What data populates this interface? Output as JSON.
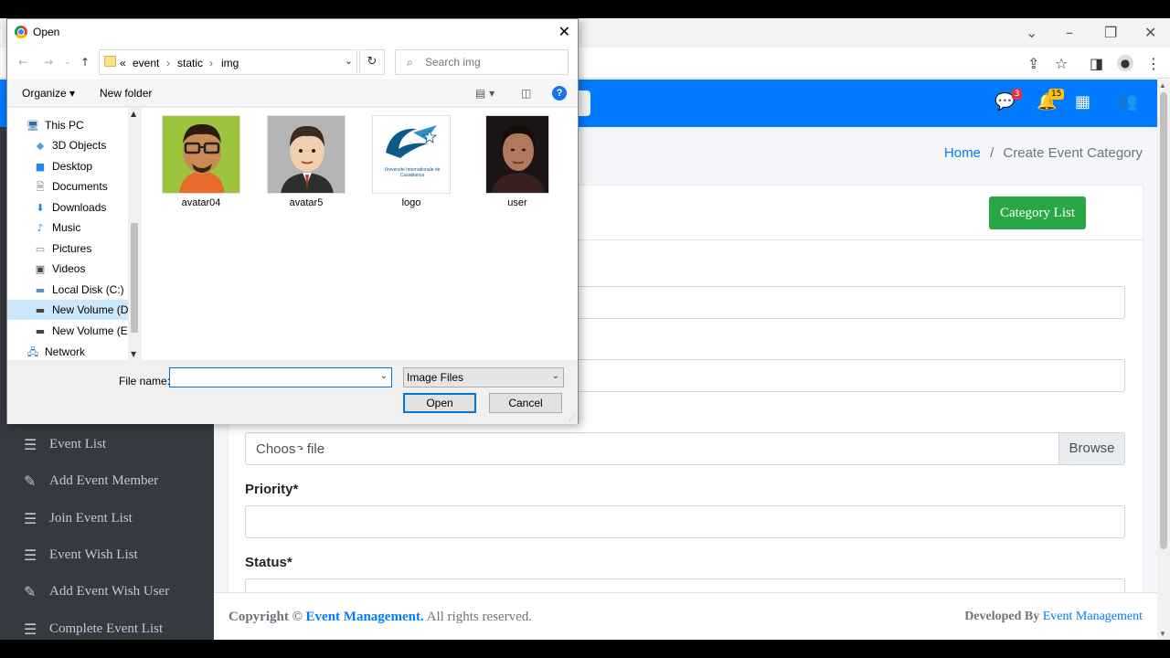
{
  "browser": {
    "controls": {
      "minimize": "–",
      "restore": "❐",
      "close": "✕",
      "tab_list": "⌄"
    }
  },
  "page": {
    "breadcrumb": {
      "home": "Home",
      "separator": "/",
      "current": "Create Event Category"
    },
    "navbar": {
      "messages_badge": "3",
      "notifications_badge": "15"
    },
    "header_button": "Category List",
    "fields": {
      "image_browse": "Browse",
      "image_placeholder": "Choose file",
      "priority_label": "Priority*",
      "status_label": "Status*"
    },
    "sidebar": [
      {
        "label": "Event List",
        "icon": "list-icon"
      },
      {
        "label": "Add Event Member",
        "icon": "edit-icon"
      },
      {
        "label": "Join Event List",
        "icon": "list-icon"
      },
      {
        "label": "Event Wish List",
        "icon": "list-icon"
      },
      {
        "label": "Add Event Wish User",
        "icon": "edit-icon"
      },
      {
        "label": "Complete Event List",
        "icon": "list-icon"
      }
    ],
    "footer": {
      "copyright_prefix": "Copyright ©",
      "brand": "Event Management.",
      "rights": "All rights reserved.",
      "developed_by": "Developed By",
      "developer": "Event Management"
    }
  },
  "dialog": {
    "title": "Open",
    "path": {
      "overflow": "«",
      "segments": [
        "event",
        "static",
        "img"
      ],
      "sep": "›"
    },
    "search_placeholder": "Search img",
    "toolbar": {
      "organize": "Organize ▾",
      "new_folder": "New folder"
    },
    "tree": [
      {
        "label": "This PC",
        "icon": "pc-icon"
      },
      {
        "label": "3D Objects",
        "icon": "cube-icon"
      },
      {
        "label": "Desktop",
        "icon": "desktop-icon"
      },
      {
        "label": "Documents",
        "icon": "document-icon"
      },
      {
        "label": "Downloads",
        "icon": "download-icon"
      },
      {
        "label": "Music",
        "icon": "music-icon"
      },
      {
        "label": "Pictures",
        "icon": "pictures-icon"
      },
      {
        "label": "Videos",
        "icon": "video-icon"
      },
      {
        "label": "Local Disk (C:)",
        "icon": "disk-icon"
      },
      {
        "label": "New Volume (D:)",
        "icon": "drive-icon",
        "selected": true
      },
      {
        "label": "New Volume (E:)",
        "icon": "drive-icon"
      },
      {
        "label": "Network",
        "icon": "network-icon"
      }
    ],
    "files": [
      {
        "name": "avatar04"
      },
      {
        "name": "avatar5"
      },
      {
        "name": "logo",
        "logo_text": "Université Internationale de Casablanca"
      },
      {
        "name": "user"
      }
    ],
    "file_name_label": "File name:",
    "file_name_value": "",
    "file_type": "Image Files",
    "open_button": "Open",
    "cancel_button": "Cancel"
  }
}
